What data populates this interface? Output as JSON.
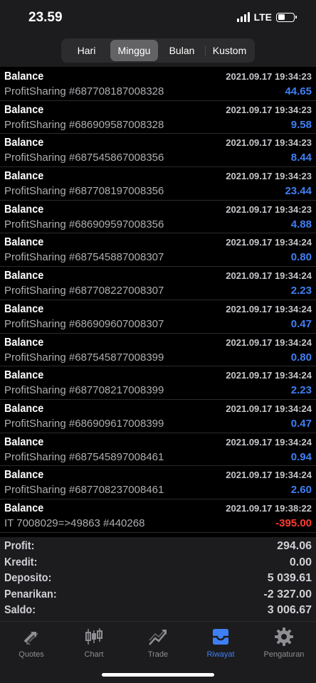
{
  "status": {
    "time": "23.59",
    "network": "LTE"
  },
  "period_tabs": [
    {
      "label": "Hari",
      "active": false
    },
    {
      "label": "Minggu",
      "active": true
    },
    {
      "label": "Bulan",
      "active": false
    },
    {
      "label": "Kustom",
      "active": false
    }
  ],
  "transactions": [
    {
      "title": "Balance",
      "date": "2021.09.17 19:34:23",
      "comment": "ProfitSharing #687708187008328",
      "amount": "44.65",
      "sign": "pos"
    },
    {
      "title": "Balance",
      "date": "2021.09.17 19:34:23",
      "comment": "ProfitSharing #686909587008328",
      "amount": "9.58",
      "sign": "pos"
    },
    {
      "title": "Balance",
      "date": "2021.09.17 19:34:23",
      "comment": "ProfitSharing #687545867008356",
      "amount": "8.44",
      "sign": "pos"
    },
    {
      "title": "Balance",
      "date": "2021.09.17 19:34:23",
      "comment": "ProfitSharing #687708197008356",
      "amount": "23.44",
      "sign": "pos"
    },
    {
      "title": "Balance",
      "date": "2021.09.17 19:34:23",
      "comment": "ProfitSharing #686909597008356",
      "amount": "4.88",
      "sign": "pos"
    },
    {
      "title": "Balance",
      "date": "2021.09.17 19:34:24",
      "comment": "ProfitSharing #687545887008307",
      "amount": "0.80",
      "sign": "pos"
    },
    {
      "title": "Balance",
      "date": "2021.09.17 19:34:24",
      "comment": "ProfitSharing #687708227008307",
      "amount": "2.23",
      "sign": "pos"
    },
    {
      "title": "Balance",
      "date": "2021.09.17 19:34:24",
      "comment": "ProfitSharing #686909607008307",
      "amount": "0.47",
      "sign": "pos"
    },
    {
      "title": "Balance",
      "date": "2021.09.17 19:34:24",
      "comment": "ProfitSharing #687545877008399",
      "amount": "0.80",
      "sign": "pos"
    },
    {
      "title": "Balance",
      "date": "2021.09.17 19:34:24",
      "comment": "ProfitSharing #687708217008399",
      "amount": "2.23",
      "sign": "pos"
    },
    {
      "title": "Balance",
      "date": "2021.09.17 19:34:24",
      "comment": "ProfitSharing #686909617008399",
      "amount": "0.47",
      "sign": "pos"
    },
    {
      "title": "Balance",
      "date": "2021.09.17 19:34:24",
      "comment": "ProfitSharing #687545897008461",
      "amount": "0.94",
      "sign": "pos"
    },
    {
      "title": "Balance",
      "date": "2021.09.17 19:34:24",
      "comment": "ProfitSharing #687708237008461",
      "amount": "2.60",
      "sign": "pos"
    },
    {
      "title": "Balance",
      "date": "2021.09.17 19:38:22",
      "comment": "IT 7008029=>49863 #440268",
      "amount": "-395.00",
      "sign": "neg"
    }
  ],
  "summary": [
    {
      "label": "Profit:",
      "value": "294.06"
    },
    {
      "label": "Kredit:",
      "value": "0.00"
    },
    {
      "label": "Deposito:",
      "value": "5 039.61"
    },
    {
      "label": "Penarikan:",
      "value": "-2 327.00"
    },
    {
      "label": "Saldo:",
      "value": "3 006.67"
    }
  ],
  "tabbar": [
    {
      "label": "Quotes",
      "icon": "quotes-icon",
      "active": false
    },
    {
      "label": "Chart",
      "icon": "candlestick-chart-icon",
      "active": false
    },
    {
      "label": "Trade",
      "icon": "trade-trend-icon",
      "active": false
    },
    {
      "label": "Riwayat",
      "icon": "history-inbox-icon",
      "active": true
    },
    {
      "label": "Pengaturan",
      "icon": "gear-icon",
      "active": false
    }
  ],
  "colors": {
    "accent": "#3f7ff5",
    "negative": "#ff3b30",
    "inactive": "#8e8e93"
  }
}
